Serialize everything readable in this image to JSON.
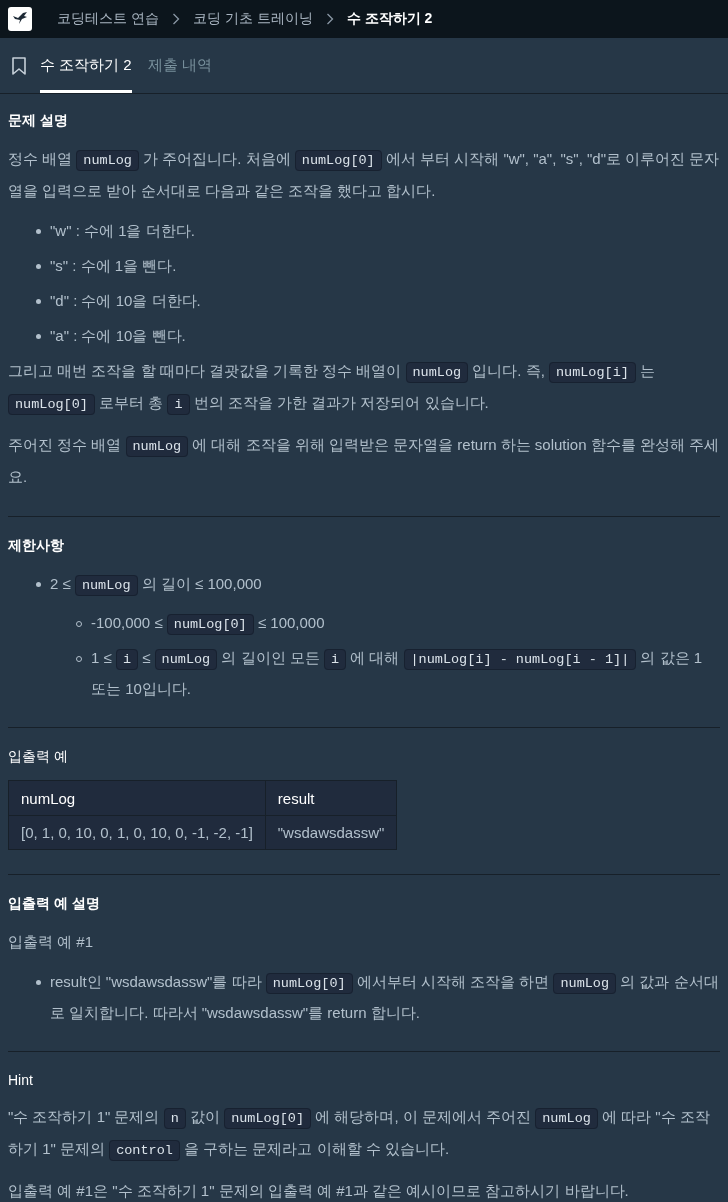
{
  "breadcrumb": [
    {
      "label": "코딩테스트 연습",
      "current": false
    },
    {
      "label": "코딩 기초 트레이닝",
      "current": false
    },
    {
      "label": "수 조작하기 2",
      "current": true
    }
  ],
  "tabs": [
    {
      "label": "수 조작하기 2",
      "selected": true
    },
    {
      "label": "제출 내역",
      "selected": false
    }
  ],
  "sections": [
    {
      "heading": "문제 설명",
      "kind": "bold",
      "blocks": [
        {
          "kind": "p",
          "parts": [
            "정수 배열 ",
            {
              "code": "numLog"
            },
            " 가 주어집니다. 처음에 ",
            {
              "code": "numLog[0]"
            },
            " 에서 부터 시작해 \"w\", \"a\", \"s\", \"d\"로 이루어진 문자열을 입력으로 받아 순서대로 다음과 같은 조작을 했다고 합시다."
          ]
        },
        {
          "kind": "ul",
          "items": [
            {
              "parts": [
                "\"w\" : 수에 1을 더한다."
              ]
            },
            {
              "parts": [
                "\"s\" : 수에 1을 뺀다."
              ]
            },
            {
              "parts": [
                "\"d\" : 수에 10을 더한다."
              ]
            },
            {
              "parts": [
                "\"a\" : 수에 10을 뺀다."
              ]
            }
          ]
        },
        {
          "kind": "p",
          "parts": [
            "그리고 매번 조작을 할 때마다 결괏값을 기록한 정수 배열이 ",
            {
              "code": "numLog"
            },
            " 입니다. 즉, ",
            {
              "code": "numLog[i]"
            },
            " 는 ",
            {
              "code": "numLog[0]"
            },
            " 로부터 총 ",
            {
              "code": "i"
            },
            " 번의 조작을 가한 결과가 저장되어 있습니다."
          ]
        },
        {
          "kind": "p",
          "parts": [
            "주어진 정수 배열 ",
            {
              "code": "numLog"
            },
            " 에 대해 조작을 위해 입력받은 문자열을 return 하는 solution 함수를 완성해 주세요."
          ]
        }
      ]
    },
    {
      "heading": "제한사항",
      "kind": "bold",
      "blocks": [
        {
          "kind": "ul",
          "items": [
            {
              "parts": [
                "2 ≤ ",
                {
                  "code": "numLog"
                },
                " 의 길이 ≤ 100,000"
              ],
              "children": [
                {
                  "parts": [
                    "-100,000 ≤ ",
                    {
                      "code": "numLog[0]"
                    },
                    " ≤ 100,000"
                  ]
                },
                {
                  "parts": [
                    "1 ≤ ",
                    {
                      "code": "i"
                    },
                    " ≤ ",
                    {
                      "code": "numLog"
                    },
                    " 의 길이인 모든 ",
                    {
                      "code": "i"
                    },
                    " 에 대해 ",
                    {
                      "code": "|numLog[i] - numLog[i - 1]|"
                    },
                    " 의 값은 1 또는 10입니다."
                  ]
                }
              ]
            }
          ]
        }
      ]
    },
    {
      "heading": "입출력 예",
      "kind": "plain",
      "blocks": [
        {
          "kind": "table",
          "columns": [
            "numLog",
            "result"
          ],
          "rows": [
            [
              "[0, 1, 0, 10, 0, 1, 0, 10, 0, -1, -2, -1]",
              "\"wsdawsdassw\""
            ]
          ]
        }
      ]
    },
    {
      "heading": "입출력 예 설명",
      "kind": "bold",
      "blocks": [
        {
          "kind": "p",
          "parts": [
            "입출력 예 #1"
          ]
        },
        {
          "kind": "ul",
          "items": [
            {
              "parts": [
                "result인 \"wsdawsdassw\"를 따라 ",
                {
                  "code": "numLog[0]"
                },
                " 에서부터 시작해 조작을 하면 ",
                {
                  "code": "numLog"
                },
                " 의 값과 순서대로 일치합니다. 따라서 \"wsdawsdassw\"를 return 합니다."
              ]
            }
          ]
        }
      ]
    },
    {
      "heading": "Hint",
      "kind": "plain",
      "blocks": [
        {
          "kind": "p",
          "parts": [
            "\"수 조작하기 1\" 문제의 ",
            {
              "code": "n"
            },
            " 값이 ",
            {
              "code": "numLog[0]"
            },
            " 에 해당하며, 이 문제에서 주어진 ",
            {
              "code": "numLog"
            },
            " 에 따라 \"수 조작하기 1\" 문제의 ",
            {
              "code": "control"
            },
            " 을 구하는 문제라고 이해할 수 있습니다."
          ]
        },
        {
          "kind": "p",
          "parts": [
            "입출력 예 #1은 \"수 조작하기 1\" 문제의 입출력 예 #1과 같은 예시이므로 참고하시기 바랍니다."
          ]
        }
      ]
    }
  ]
}
